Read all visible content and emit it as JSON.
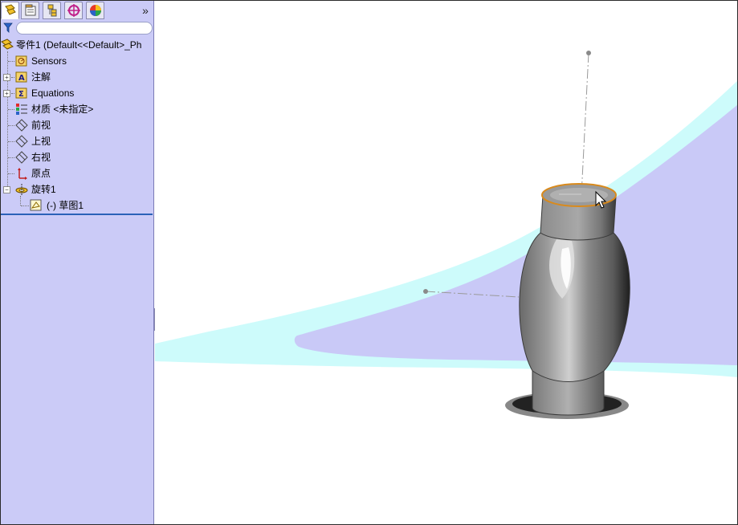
{
  "feature_manager": {
    "tabs": [
      {
        "name": "featuremanager-tab",
        "icon": "feature-tree-icon"
      },
      {
        "name": "propertymanager-tab",
        "icon": "property-manager-icon"
      },
      {
        "name": "configurationmanager-tab",
        "icon": "configuration-manager-icon"
      },
      {
        "name": "dimxpert-tab",
        "icon": "dimxpert-icon"
      },
      {
        "name": "displaymanager-tab",
        "icon": "display-manager-icon"
      }
    ],
    "more_tabs_label": "»",
    "tree": {
      "root": "零件1  (Default<<Default>_Ph",
      "items": [
        {
          "label": "Sensors",
          "icon": "sensors-folder-icon",
          "expandable": false
        },
        {
          "label": "注解",
          "icon": "annotations-folder-icon",
          "expandable": true
        },
        {
          "label": "Equations",
          "icon": "equations-folder-icon",
          "expandable": true
        },
        {
          "label": "材质 <未指定>",
          "icon": "material-icon",
          "expandable": false
        },
        {
          "label": "前视",
          "icon": "plane-icon",
          "expandable": false
        },
        {
          "label": "上视",
          "icon": "plane-icon",
          "expandable": false
        },
        {
          "label": "右视",
          "icon": "plane-icon",
          "expandable": false
        },
        {
          "label": "原点",
          "icon": "origin-icon",
          "expandable": false
        },
        {
          "label": "旋转1",
          "icon": "revolve-feature-icon",
          "expandable": true,
          "expanded": true
        },
        {
          "label": "(-) 草图1",
          "icon": "sketch-icon",
          "child": true
        }
      ]
    }
  },
  "colors": {
    "panel_bg": "#cbcbf7",
    "floor_lavender": "#c9c9f7",
    "floor_cyan": "#cdfbfb",
    "edge_highlight": "#d98a1c",
    "selection_bar": "#2a62b8"
  }
}
